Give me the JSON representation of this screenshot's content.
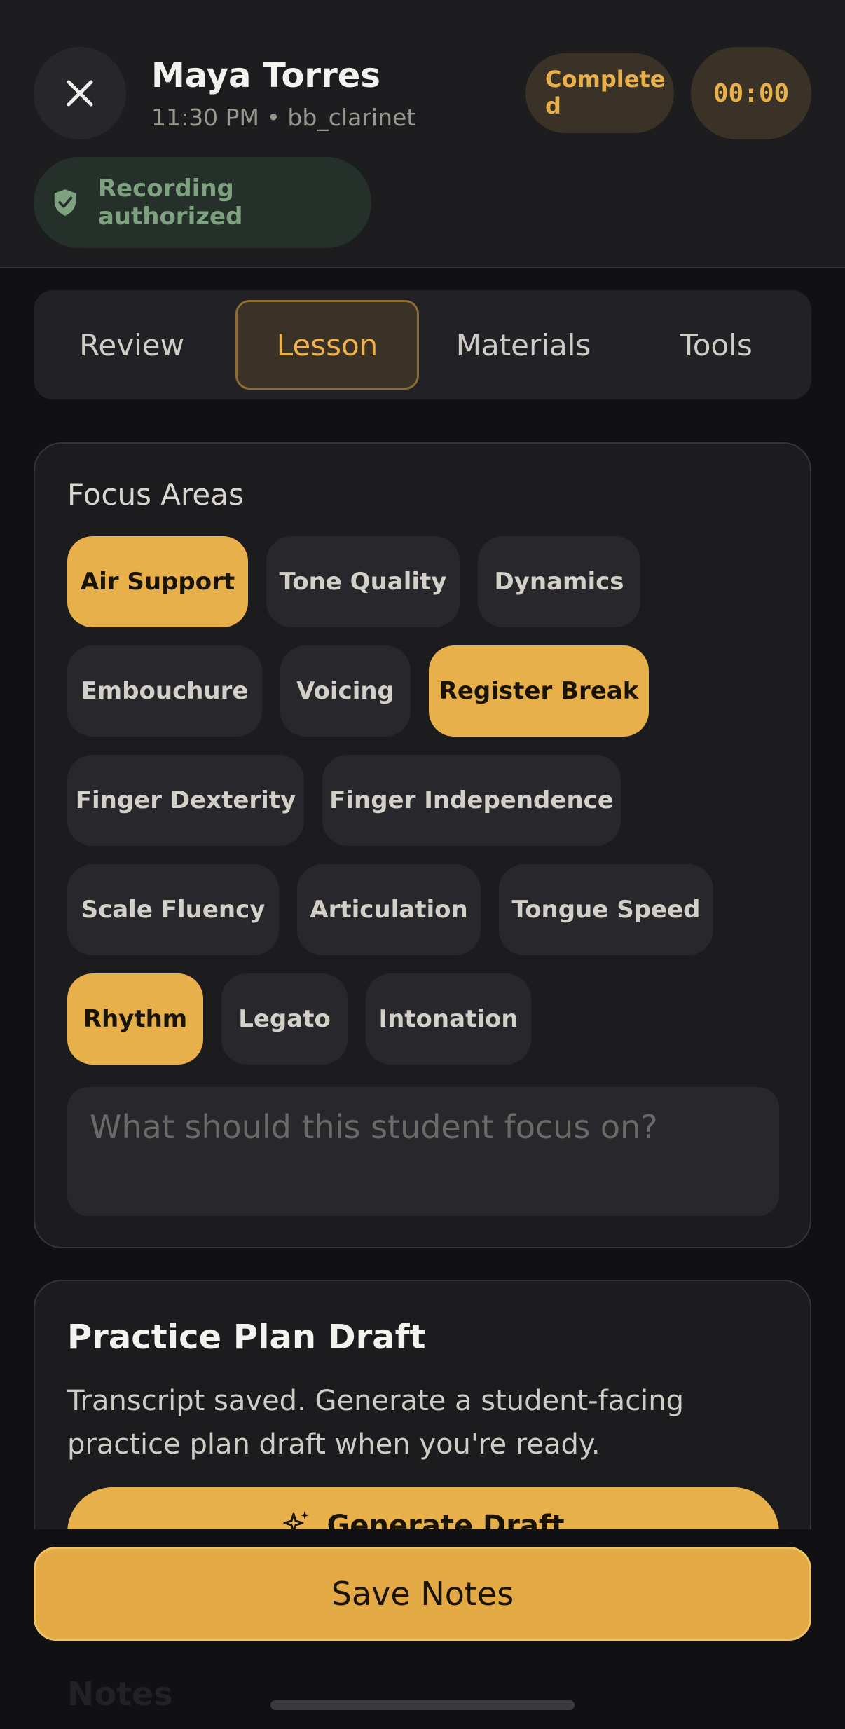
{
  "header": {
    "student_name": "Maya Torres",
    "session_meta": "11:30 PM • bb_clarinet",
    "status_badge": "Completed",
    "timer": "00:00",
    "recording_status": "Recording authorized"
  },
  "tabs": [
    {
      "label": "Review",
      "active": false
    },
    {
      "label": "Lesson",
      "active": true
    },
    {
      "label": "Materials",
      "active": false
    },
    {
      "label": "Tools",
      "active": false
    }
  ],
  "focus_areas": {
    "title": "Focus Areas",
    "chips": [
      {
        "label": "Air Support",
        "selected": true
      },
      {
        "label": "Tone Quality",
        "selected": false
      },
      {
        "label": "Dynamics",
        "selected": false
      },
      {
        "label": "Embouchure",
        "selected": false
      },
      {
        "label": "Voicing",
        "selected": false
      },
      {
        "label": "Register Break",
        "selected": true
      },
      {
        "label": "Finger Dexterity",
        "selected": false
      },
      {
        "label": "Finger Independence",
        "selected": false
      },
      {
        "label": "Scale Fluency",
        "selected": false
      },
      {
        "label": "Articulation",
        "selected": false
      },
      {
        "label": "Tongue Speed",
        "selected": false
      },
      {
        "label": "Rhythm",
        "selected": true
      },
      {
        "label": "Legato",
        "selected": false
      },
      {
        "label": "Intonation",
        "selected": false
      }
    ],
    "input_placeholder": "What should this student focus on?",
    "input_value": ""
  },
  "practice_plan": {
    "title": "Practice Plan Draft",
    "description": "Transcript saved. Generate a student-facing practice plan draft when you're ready.",
    "generate_label": "Generate Draft"
  },
  "footer": {
    "save_label": "Save Notes",
    "notes_peek": "Notes"
  },
  "colors": {
    "accent": "#e8b04a",
    "background": "#111113",
    "card": "#1c1c1f",
    "success": "#7ea27f"
  },
  "icons": {
    "close": "close-icon",
    "shield": "shield-check-icon",
    "sparkle": "sparkle-icon"
  }
}
